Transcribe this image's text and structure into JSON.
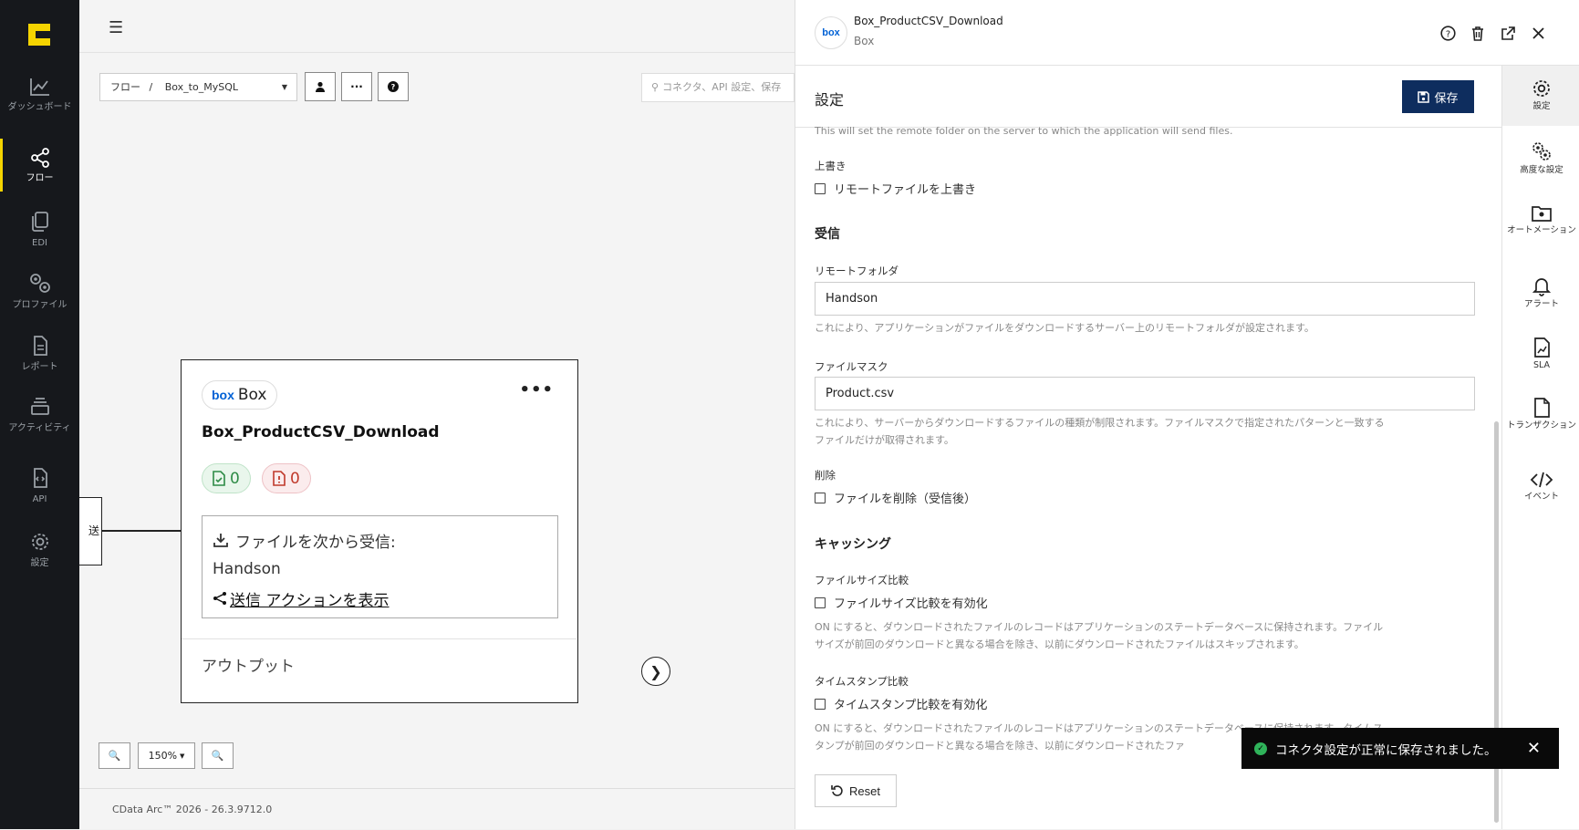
{
  "nav": {
    "items": [
      {
        "label": "ダッシュボード"
      },
      {
        "label": "フロー"
      },
      {
        "label": "EDI"
      },
      {
        "label": "プロファイル"
      },
      {
        "label": "レポート"
      },
      {
        "label": "アクティビティ"
      },
      {
        "label": "API"
      },
      {
        "label": "設定"
      }
    ],
    "active": "フロー"
  },
  "canvas": {
    "breadcrumb_root": "フロー",
    "breadcrumb_sep": "/",
    "flow_name": "Box_to_MySQL",
    "search_placeholder": "コネクタ、API 設定、保存",
    "left_node_text": "送",
    "card": {
      "connector_type": "Box",
      "title": "Box_ProductCSV_Download",
      "success_count": "0",
      "error_count": "0",
      "receive_label": "ファイルを次から受信:",
      "receive_folder": "Handson",
      "send_action_link": "送信 アクションを表示",
      "output_label": "アウトプット"
    },
    "zoom_level": "150%",
    "footer": "CData Arc™ 2026 - 26.3.9712.0"
  },
  "panel": {
    "connector_name": "Box_ProductCSV_Download",
    "connector_type": "Box",
    "logo_text": "box",
    "settings_title": "設定",
    "save_label": "保存",
    "remote_folder_hint_top": "This will set the remote folder on the server to which the application will send files.",
    "overwrite_label": "上書き",
    "overwrite_checkbox": "リモートファイルを上書き",
    "receive_section": "受信",
    "remote_folder_label": "リモートフォルダ",
    "remote_folder_value": "Handson",
    "remote_folder_hint": "これにより、アプリケーションがファイルをダウンロードするサーバー上のリモートフォルダが設定されます。",
    "file_mask_label": "ファイルマスク",
    "file_mask_value": "Product.csv",
    "file_mask_hint_1": "これにより、サーバーからダウンロードするファイルの種類が制限されます。ファイルマスクで指定されたパターンと一致する",
    "file_mask_hint_2": "ファイルだけが取得されます。",
    "delete_label": "削除",
    "delete_checkbox": "ファイルを削除（受信後）",
    "caching_section": "キャッシング",
    "size_compare_label": "ファイルサイズ比較",
    "size_compare_checkbox": "ファイルサイズ比較を有効化",
    "size_compare_hint_1": "ON にすると、ダウンロードされたファイルのレコードはアプリケーションのステートデータベースに保持されます。ファイル",
    "size_compare_hint_2": "サイズが前回のダウンロードと異なる場合を除き、以前にダウンロードされたファイルはスキップされます。",
    "timestamp_label": "タイムスタンプ比較",
    "timestamp_checkbox": "タイムスタンプ比較を有効化",
    "timestamp_hint_1": "ON にすると、ダウンロードされたファイルのレコードはアプリケーションのステートデータベースに保持されます。タイムス",
    "timestamp_hint_2": "タンプが前回のダウンロードと異なる場合を除き、以前にダウンロードされたファ",
    "reset_label": "Reset",
    "side_tabs": [
      {
        "label": "設定"
      },
      {
        "label": "高度な設定"
      },
      {
        "label": "オートメーション"
      },
      {
        "label": "アラート"
      },
      {
        "label": "SLA"
      },
      {
        "label": "トランザクション"
      },
      {
        "label": "イベント"
      }
    ]
  },
  "toast": {
    "message": "コネクタ設定が正常に保存されました。"
  },
  "colors": {
    "nav_bg": "#16181c",
    "accent_yellow": "#f5d400",
    "save_button": "#0e2d5e",
    "success_green": "#2fb35a",
    "error_red": "#c0392b"
  }
}
